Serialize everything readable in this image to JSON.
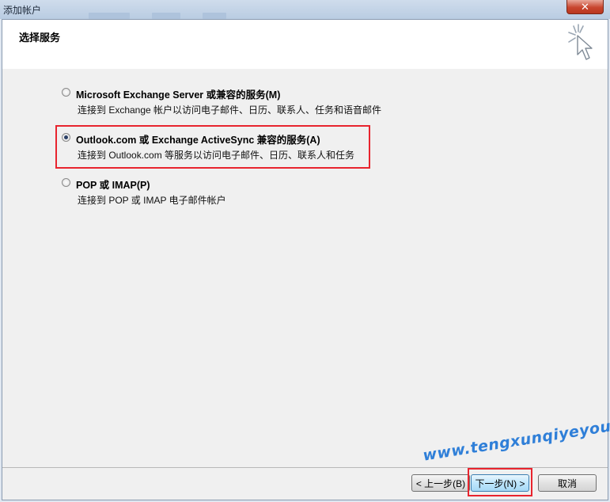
{
  "window": {
    "title": "添加帐户",
    "close_glyph": "✕"
  },
  "header": {
    "title": "选择服务",
    "icon": "wizard-cursor-icon"
  },
  "options": [
    {
      "label": "Microsoft Exchange Server 或兼容的服务(M)",
      "description": "连接到 Exchange 帐户以访问电子邮件、日历、联系人、任务和语音邮件",
      "selected": false
    },
    {
      "label": "Outlook.com 或 Exchange ActiveSync 兼容的服务(A)",
      "description": "连接到 Outlook.com 等服务以访问电子邮件、日历、联系人和任务",
      "selected": true
    },
    {
      "label": "POP 或 IMAP(P)",
      "description": "连接到 POP 或 IMAP 电子邮件帐户",
      "selected": false
    }
  ],
  "buttons": {
    "back": "< 上一步(B)",
    "next": "下一步(N) >",
    "cancel": "取消"
  },
  "watermark": "www.tengxunqiyeyou.com",
  "colors": {
    "highlight": "#e8242e",
    "watermark": "#2f7fd8"
  }
}
